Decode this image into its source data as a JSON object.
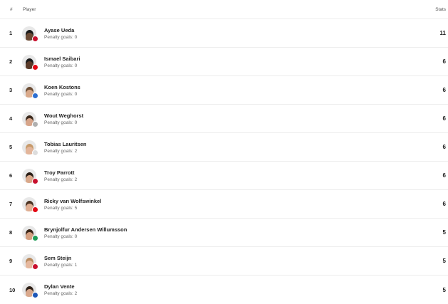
{
  "header": {
    "rank": "#",
    "player": "Player",
    "stats": "Stats"
  },
  "players": [
    {
      "rank": "1",
      "name": "Ayase Ueda",
      "penalty": "Penalty goals: 0",
      "stat": "11",
      "skin": "#6b4a34",
      "hair": "#1a1a1a",
      "club": "#c8102e"
    },
    {
      "rank": "2",
      "name": "Ismael Saibari",
      "penalty": "Penalty goals: 0",
      "stat": "6",
      "skin": "#5a3a28",
      "hair": "#1a1a1a",
      "club": "#e30613"
    },
    {
      "rank": "3",
      "name": "Koen Kostons",
      "penalty": "Penalty goals: 0",
      "stat": "6",
      "skin": "#d9a98a",
      "hair": "#6b4c33",
      "club": "#2d6fd1"
    },
    {
      "rank": "4",
      "name": "Wout Weghorst",
      "penalty": "Penalty goals: 0",
      "stat": "6",
      "skin": "#d7a58a",
      "hair": "#3c2a1e",
      "club": "#b0b0b0"
    },
    {
      "rank": "5",
      "name": "Tobias Lauritsen",
      "penalty": "Penalty goals: 2",
      "stat": "6",
      "skin": "#e3b59a",
      "hair": "#c79a6a",
      "club": "#dddddd"
    },
    {
      "rank": "6",
      "name": "Troy Parrott",
      "penalty": "Penalty goals: 2",
      "stat": "6",
      "skin": "#d9a88a",
      "hair": "#2a1e16",
      "club": "#c8102e"
    },
    {
      "rank": "7",
      "name": "Ricky van Wolfswinkel",
      "penalty": "Penalty goals: 5",
      "stat": "6",
      "skin": "#dfae92",
      "hair": "#4a3222",
      "club": "#e30613"
    },
    {
      "rank": "8",
      "name": "Brynjolfur Andersen Willumsson",
      "penalty": "Penalty goals: 0",
      "stat": "5",
      "skin": "#d5a080",
      "hair": "#3a2618",
      "club": "#1f9e57"
    },
    {
      "rank": "9",
      "name": "Sem Steijn",
      "penalty": "Penalty goals: 1",
      "stat": "5",
      "skin": "#e6b89e",
      "hair": "#b98a5e",
      "club": "#c8102e"
    },
    {
      "rank": "10",
      "name": "Dylan Vente",
      "penalty": "Penalty goals: 2",
      "stat": "5",
      "skin": "#d9a88c",
      "hair": "#2e2118",
      "club": "#1d57b8"
    }
  ]
}
